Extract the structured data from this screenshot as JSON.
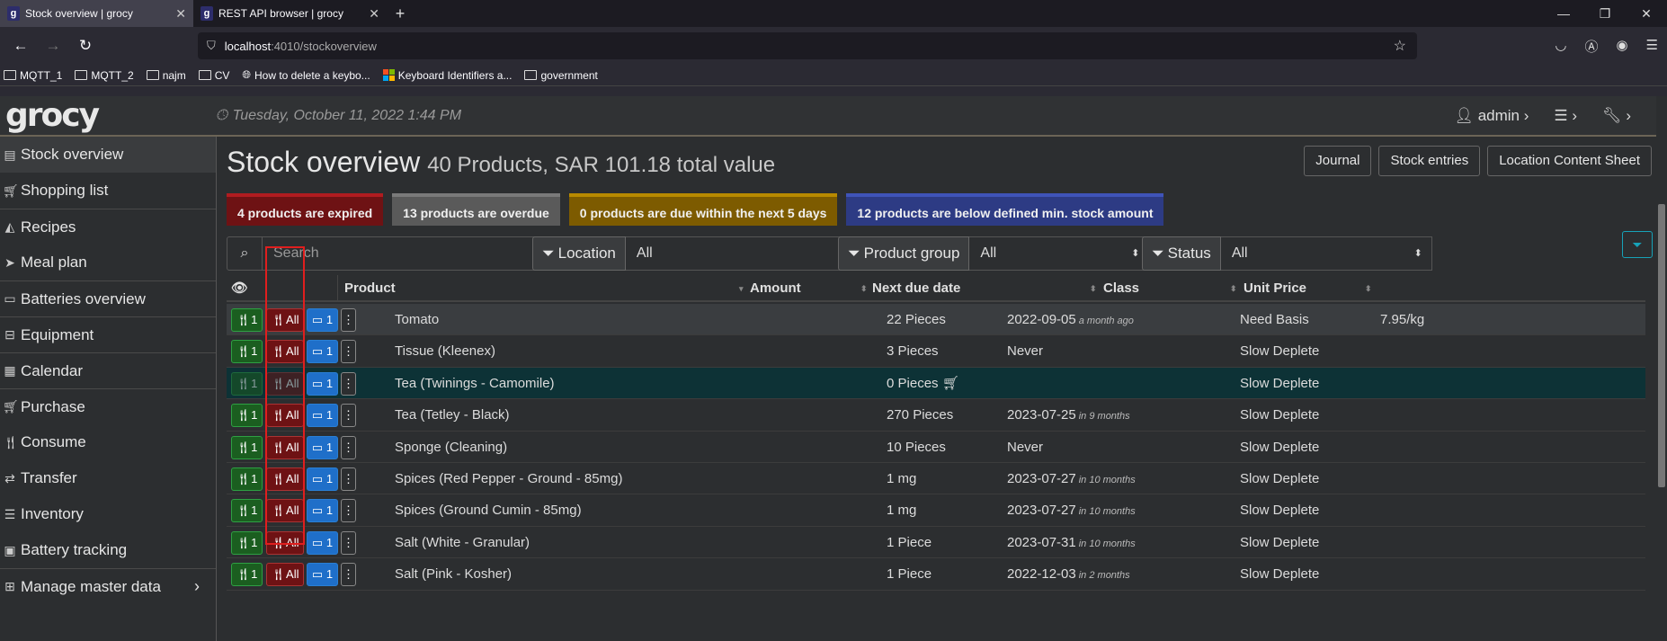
{
  "browser": {
    "tabs": [
      {
        "favicon": "g",
        "title": "Stock overview | grocy",
        "active": true
      },
      {
        "favicon": "g",
        "title": "REST API browser | grocy",
        "active": false
      }
    ],
    "url_host": "localhost",
    "url_path": ":4010/stockoverview",
    "bookmarks": [
      "MQTT_1",
      "MQTT_2",
      "najm",
      "CV",
      "How to delete a keybo...",
      "Keyboard Identifiers a...",
      "government"
    ]
  },
  "app": {
    "logo": "grocy",
    "datetime": "Tuesday, October 11, 2022 1:44 PM",
    "user": "admin"
  },
  "sidebar": {
    "items": [
      {
        "label": "Stock overview",
        "icon": "box-icon"
      },
      {
        "label": "Shopping list",
        "icon": "cart-icon"
      },
      {
        "label": "Recipes",
        "icon": "pizza-icon"
      },
      {
        "label": "Meal plan",
        "icon": "paper-plane-icon"
      },
      {
        "label": "Batteries overview",
        "icon": "battery-icon"
      },
      {
        "label": "Equipment",
        "icon": "toolbox-icon"
      },
      {
        "label": "Calendar",
        "icon": "calendar-icon"
      },
      {
        "label": "Purchase",
        "icon": "cart-plus-icon"
      },
      {
        "label": "Consume",
        "icon": "utensils-icon"
      },
      {
        "label": "Transfer",
        "icon": "exchange-icon"
      },
      {
        "label": "Inventory",
        "icon": "list-icon"
      },
      {
        "label": "Battery tracking",
        "icon": "car-battery-icon"
      },
      {
        "label": "Manage master data",
        "icon": "table-icon"
      }
    ]
  },
  "page": {
    "title": "Stock overview",
    "subtitle": "40 Products, SAR 101.18 total value",
    "buttons": {
      "journal": "Journal",
      "entries": "Stock entries",
      "sheet": "Location Content Sheet"
    },
    "badges": {
      "expired": "4 products are expired",
      "overdue": "13 products are overdue",
      "due": "0 products are due within the next 5 days",
      "below": "12 products are below defined min. stock amount"
    },
    "search_placeholder": "Search",
    "filters": {
      "location_label": "Location",
      "location_value": "All",
      "group_label": "Product group",
      "group_value": "All",
      "status_label": "Status",
      "status_value": "All"
    },
    "columns": {
      "product": "Product",
      "amount": "Amount",
      "due": "Next due date",
      "class": "Class",
      "price": "Unit Price"
    },
    "btn_labels": {
      "consume_one": "1",
      "consume_all": "All",
      "open_one": "1"
    },
    "rows": [
      {
        "product": "Tomato",
        "amount": "22 Pieces",
        "due": "2022-09-05",
        "rel": "a month ago",
        "class": "Need Basis",
        "price": "7.95/kg"
      },
      {
        "product": "Tissue (Kleenex)",
        "amount": "3 Pieces",
        "due": "Never",
        "rel": "",
        "class": "Slow Deplete",
        "price": ""
      },
      {
        "product": "Tea (Twinings - Camomile)",
        "amount": "0 Pieces",
        "due": "",
        "rel": "",
        "class": "Slow Deplete",
        "price": ""
      },
      {
        "product": "Tea (Tetley - Black)",
        "amount": "270 Pieces",
        "due": "2023-07-25",
        "rel": "in 9 months",
        "class": "Slow Deplete",
        "price": ""
      },
      {
        "product": "Sponge (Cleaning)",
        "amount": "10 Pieces",
        "due": "Never",
        "rel": "",
        "class": "Slow Deplete",
        "price": ""
      },
      {
        "product": "Spices (Red Pepper - Ground - 85mg)",
        "amount": "1 mg",
        "due": "2023-07-27",
        "rel": "in 10 months",
        "class": "Slow Deplete",
        "price": ""
      },
      {
        "product": "Spices (Ground Cumin - 85mg)",
        "amount": "1 mg",
        "due": "2023-07-27",
        "rel": "in 10 months",
        "class": "Slow Deplete",
        "price": ""
      },
      {
        "product": "Salt (White - Granular)",
        "amount": "1 Piece",
        "due": "2023-07-31",
        "rel": "in 10 months",
        "class": "Slow Deplete",
        "price": ""
      },
      {
        "product": "Salt (Pink - Kosher)",
        "amount": "1 Piece",
        "due": "2022-12-03",
        "rel": "in 2 months",
        "class": "Slow Deplete",
        "price": ""
      }
    ]
  }
}
